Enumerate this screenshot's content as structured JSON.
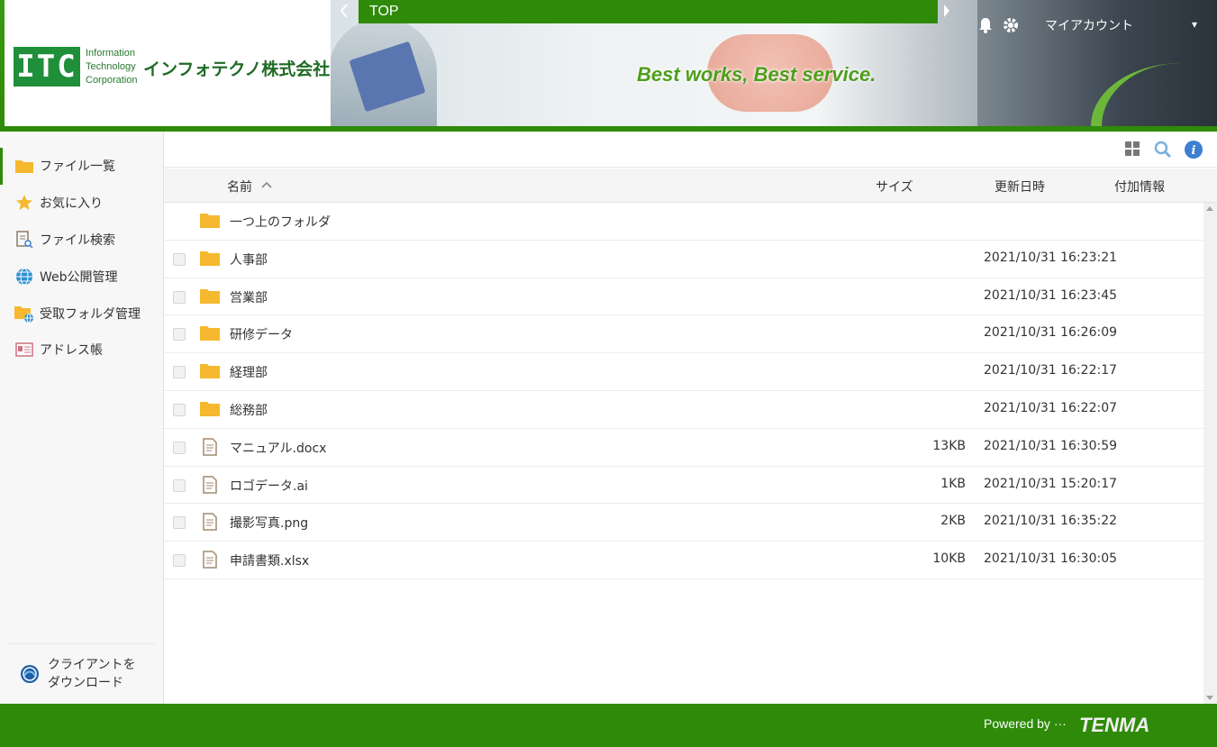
{
  "header": {
    "logo_mark": "ITC",
    "logo_sub": [
      "Information",
      "Technology",
      "Corporation"
    ],
    "company_name": "インフォテクノ株式会社",
    "banner_slogan": "Best  works, Best  service.",
    "breadcrumb_top": "TOP",
    "account_label": "マイアカウント"
  },
  "sidebar": {
    "items": [
      {
        "label": "ファイル一覧",
        "icon": "folder-icon"
      },
      {
        "label": "お気に入り",
        "icon": "star-icon"
      },
      {
        "label": "ファイル検索",
        "icon": "file-search-icon"
      },
      {
        "label": "Web公開管理",
        "icon": "globe-icon"
      },
      {
        "label": "受取フォルダ管理",
        "icon": "folder-globe-icon"
      },
      {
        "label": "アドレス帳",
        "icon": "address-card-icon"
      }
    ],
    "download_line1": "クライアントを",
    "download_line2": "ダウンロード"
  },
  "table": {
    "columns": {
      "name": "名前",
      "size": "サイズ",
      "date": "更新日時",
      "extra": "付加情報"
    },
    "parent_folder": "一つ上のフォルダ",
    "rows": [
      {
        "type": "folder",
        "name": "人事部",
        "size": "",
        "date": "2021/10/31 16:23:21"
      },
      {
        "type": "folder",
        "name": "営業部",
        "size": "",
        "date": "2021/10/31 16:23:45"
      },
      {
        "type": "folder",
        "name": "研修データ",
        "size": "",
        "date": "2021/10/31 16:26:09"
      },
      {
        "type": "folder",
        "name": "経理部",
        "size": "",
        "date": "2021/10/31 16:22:17"
      },
      {
        "type": "folder",
        "name": "総務部",
        "size": "",
        "date": "2021/10/31 16:22:07"
      },
      {
        "type": "file",
        "name": "マニュアル.docx",
        "size": "13KB",
        "date": "2021/10/31 16:30:59"
      },
      {
        "type": "file",
        "name": "ロゴデータ.ai",
        "size": "1KB",
        "date": "2021/10/31 15:20:17"
      },
      {
        "type": "file",
        "name": "撮影写真.png",
        "size": "2KB",
        "date": "2021/10/31 16:35:22"
      },
      {
        "type": "file",
        "name": "申請書類.xlsx",
        "size": "10KB",
        "date": "2021/10/31 16:30:05"
      }
    ]
  },
  "footer": {
    "powered_by": "Powered by ···",
    "brand": "TENMA"
  },
  "colors": {
    "brand_green": "#2e8a08",
    "folder_yellow": "#f5b82e",
    "info_blue": "#3d7fd0"
  }
}
